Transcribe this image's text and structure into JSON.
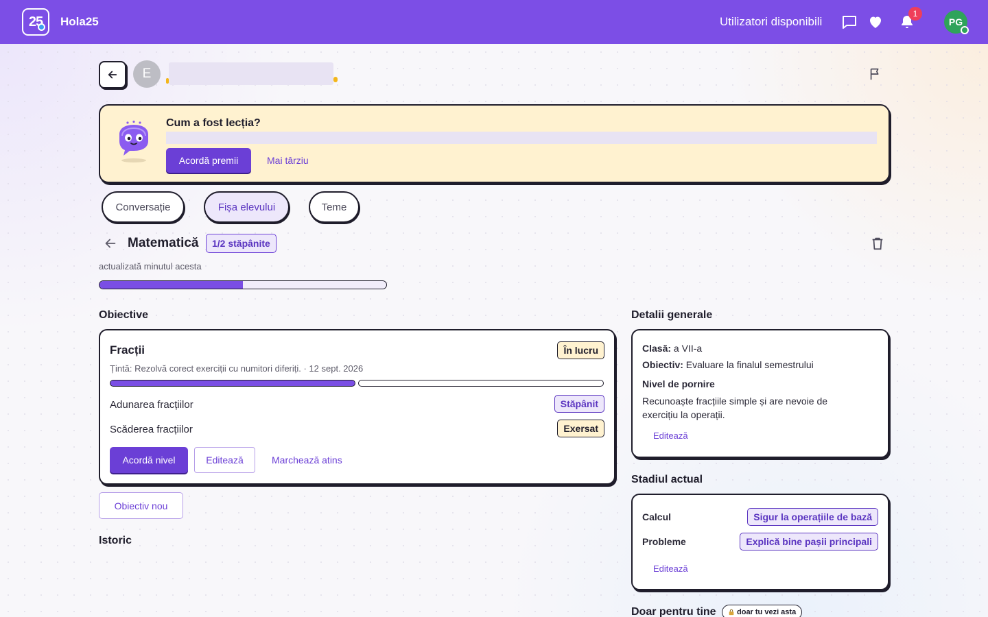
{
  "topbar": {
    "logo_text": "25",
    "brand": "Hola25",
    "available_users": "Utilizatori disponibili",
    "notification_count": "1",
    "avatar_initials": "PG"
  },
  "header": {
    "student_initial": "E"
  },
  "banner": {
    "title": "Cum a fost lecția?",
    "primary_button": "Acordă premii",
    "later_button": "Mai târziu"
  },
  "tabs": [
    {
      "label": "Conversație",
      "active": false
    },
    {
      "label": "Fișa elevului",
      "active": true
    },
    {
      "label": "Teme",
      "active": false
    }
  ],
  "subject": {
    "title": "Matematică",
    "mastered_badge": "1/2 stăpânite",
    "updated": "actualizată minutul acesta",
    "progress": 0.5
  },
  "objectives": {
    "section_title": "Obiective",
    "card": {
      "title": "Fracții",
      "status": "În lucru",
      "target": "Țintă: Rezolvă corect exerciții cu numitori diferiți. · 12 sept. 2026",
      "progress": 0.5,
      "skills": [
        {
          "label": "Adunarea fracțiilor",
          "level": "Stăpânit"
        },
        {
          "label": "Scăderea fracțiilor",
          "level": "Exersat"
        }
      ],
      "award_button": "Acordă nivel",
      "edit_button": "Editează",
      "mark_button": "Marchează atins"
    },
    "new_button": "Obiectiv nou"
  },
  "history": {
    "section_title": "Istoric"
  },
  "details": {
    "section_title": "Detalii generale",
    "class_label": "Clasă:",
    "class_value": "a VII-a",
    "objective_label": "Obiectiv:",
    "objective_value": "Evaluare la finalul semestrului",
    "start_level_label": "Nivel de pornire",
    "start_level_value": "Recunoaște fracțiile simple și are nevoie de exercițiu la operații.",
    "edit": "Editează"
  },
  "current_stage": {
    "section_title": "Stadiul actual",
    "rows": [
      {
        "label": "Calcul",
        "value": "Sigur la operațiile de bază"
      },
      {
        "label": "Probleme",
        "value": "Explică bine pașii principali"
      }
    ],
    "edit": "Editează"
  },
  "private": {
    "section_title": "Doar pentru tine",
    "badge": "doar tu vezi asta"
  },
  "colors": {
    "brand": "#7c4ee6",
    "accent": "#6b3fd6",
    "banner_bg": "#fff2d0",
    "online": "#2fa35a",
    "notification": "#ef3e5a"
  }
}
